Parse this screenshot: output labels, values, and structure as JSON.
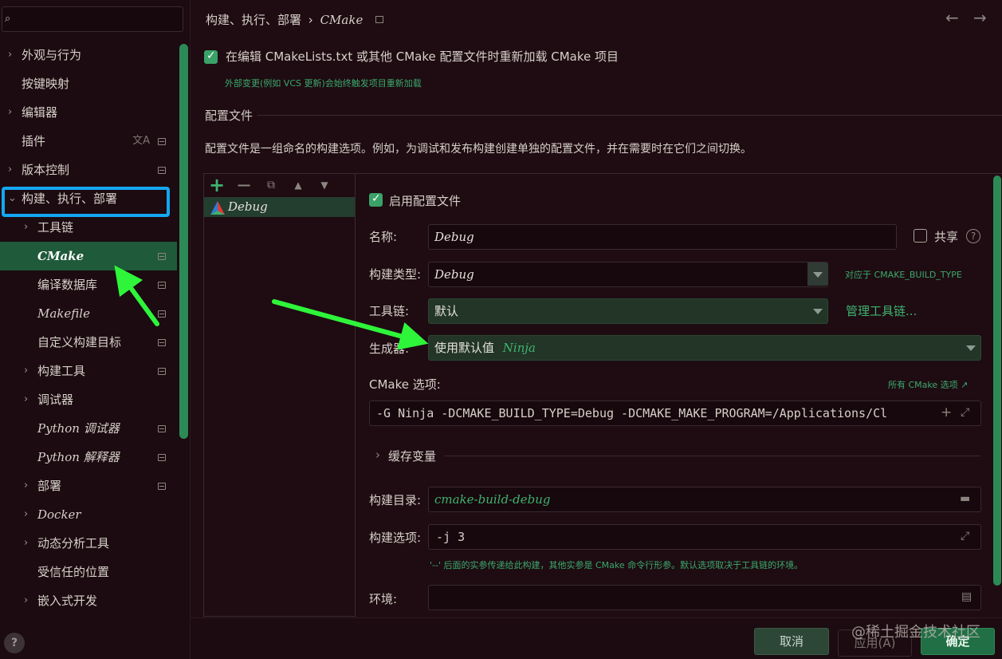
{
  "sidebar": {
    "search_placeholder": "",
    "items": [
      {
        "label": "外观与行为",
        "chevron": "›",
        "indent": 0
      },
      {
        "label": "按键映射",
        "chevron": "",
        "indent": 0
      },
      {
        "label": "编辑器",
        "chevron": "›",
        "indent": 0
      },
      {
        "label": "插件",
        "chevron": "",
        "indent": 0
      },
      {
        "label": "版本控制",
        "chevron": "›",
        "indent": 0
      },
      {
        "label": "构建、执行、部署",
        "chevron": "⌄",
        "indent": 0
      },
      {
        "label": "工具链",
        "chevron": "›",
        "indent": 1
      },
      {
        "label": "CMake",
        "chevron": "",
        "indent": 1
      },
      {
        "label": "编译数据库",
        "chevron": "",
        "indent": 1
      },
      {
        "label": "Makefile",
        "chevron": "",
        "indent": 1
      },
      {
        "label": "自定义构建目标",
        "chevron": "",
        "indent": 1
      },
      {
        "label": "构建工具",
        "chevron": "›",
        "indent": 1
      },
      {
        "label": "调试器",
        "chevron": "›",
        "indent": 1
      },
      {
        "label": "Python 调试器",
        "chevron": "",
        "indent": 1
      },
      {
        "label": "Python 解释器",
        "chevron": "",
        "indent": 1
      },
      {
        "label": "部署",
        "chevron": "›",
        "indent": 1
      },
      {
        "label": "Docker",
        "chevron": "›",
        "indent": 1
      },
      {
        "label": "动态分析工具",
        "chevron": "›",
        "indent": 1
      },
      {
        "label": "受信任的位置",
        "chevron": "",
        "indent": 1
      },
      {
        "label": "嵌入式开发",
        "chevron": "›",
        "indent": 1
      }
    ],
    "help_label": "?"
  },
  "header": {
    "breadcrumb_parent": "构建、执行、部署",
    "breadcrumb_sep": "›",
    "breadcrumb_current": "CMake",
    "back_icon": "←",
    "forward_icon": "→"
  },
  "reload": {
    "checked": true,
    "label": "在编辑 CMakeLists.txt 或其他 CMake 配置文件时重新加载 CMake 项目",
    "hint": "外部变更(例如 VCS 更新)会始终触发项目重新加载"
  },
  "profiles_section": {
    "title": "配置文件",
    "description": "配置文件是一组命名的构建选项。例如，为调试和发布构建创建单独的配置文件，并在需要时在它们之间切换。"
  },
  "toolbar": {
    "add": "+",
    "remove": "−",
    "copy": "⧉",
    "up": "▲",
    "down": "▼"
  },
  "profiles": [
    {
      "name": "Debug",
      "selected": true
    }
  ],
  "form": {
    "enable_label": "启用配置文件",
    "enable_checked": true,
    "name_label": "名称:",
    "name_value": "Debug",
    "share_label": "共享",
    "share_checked": false,
    "build_type_label": "构建类型:",
    "build_type_value": "Debug",
    "build_type_hint": "对应于 CMAKE_BUILD_TYPE",
    "toolchain_label": "工具链:",
    "toolchain_value": "默认",
    "manage_toolchains": "管理工具链...",
    "generator_label": "生成器:",
    "generator_value": "使用默认值",
    "generator_default": "Ninja",
    "cmake_options_label": "CMake 选项:",
    "all_cmake_options": "所有 CMake 选项 ↗",
    "cmake_options_value": "-G Ninja -DCMAKE_BUILD_TYPE=Debug -DCMAKE_MAKE_PROGRAM=/Applications/Cl",
    "cache_vars_label": "缓存变量",
    "build_dir_label": "构建目录:",
    "build_dir_value": "cmake-build-debug",
    "build_opts_label": "构建选项:",
    "build_opts_value": "-j 3",
    "build_opts_hint": "'--' 后面的实参传递给此构建，其他实参是 CMake 命令行形参。默认选项取决于工具链的环境。",
    "env_label": "环境:",
    "env_value": ""
  },
  "buttons": {
    "cancel": "取消",
    "apply": "应用(A)",
    "ok": "确定"
  },
  "watermark": "@稀土掘金技术社区",
  "colors": {
    "accent_green": "#3fb26f",
    "selection": "#1f5a3a",
    "highlight_box": "#14a7f3",
    "annotation_arrow": "#2ef53a"
  }
}
